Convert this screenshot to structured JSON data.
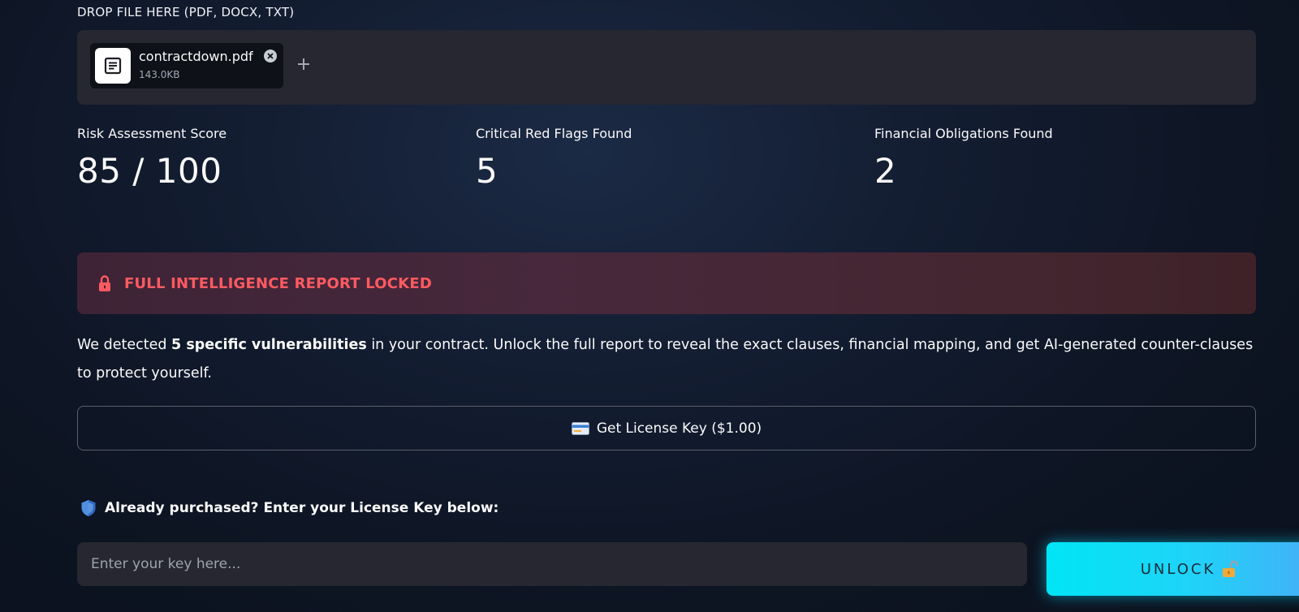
{
  "upload": {
    "label": "DROP FILE HERE (PDF, DOCX, TXT)",
    "file": {
      "name": "contractdown.pdf",
      "size": "143.0KB",
      "icon": "document-icon"
    },
    "add_icon": "plus-icon",
    "remove_icon": "close-circle-icon"
  },
  "metrics": [
    {
      "label": "Risk Assessment Score",
      "value": "85 / 100"
    },
    {
      "label": "Critical Red Flags Found",
      "value": "5"
    },
    {
      "label": "Financial Obligations Found",
      "value": "2"
    }
  ],
  "locked_banner": {
    "icon": "lock-icon",
    "text": "FULL INTELLIGENCE REPORT LOCKED",
    "text_color": "#ff5a61"
  },
  "description": {
    "prefix": "We detected ",
    "highlight": "5 specific vulnerabilities",
    "suffix": " in your contract. Unlock the full report to reveal the exact clauses, financial mapping, and get AI-generated counter-clauses to protect yourself."
  },
  "license_button": {
    "icon": "credit-card-icon",
    "label": "Get License Key ($1.00)"
  },
  "purchased": {
    "icon": "shield-icon",
    "text": "Already purchased? Enter your License Key below:"
  },
  "key_input": {
    "placeholder": "Enter your key here...",
    "value": ""
  },
  "unlock_button": {
    "label": "UNLOCK",
    "icon": "unlocked-padlock-icon",
    "gradient_start": "#00e5f5",
    "gradient_end": "#4aaaf7"
  }
}
